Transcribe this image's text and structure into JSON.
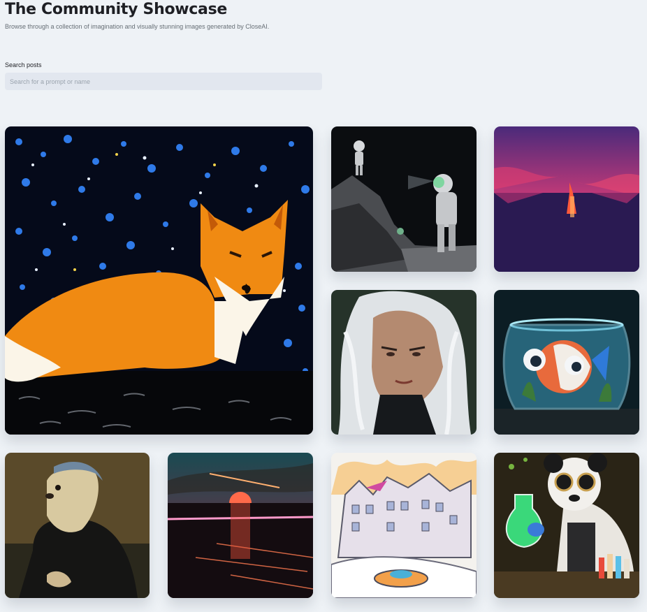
{
  "header": {
    "title": "The Community Showcase",
    "subtitle": "Browse through a collection of imagination and visually stunning images generated by CloseAI."
  },
  "search": {
    "label": "Search posts",
    "placeholder": "Search for a prompt or name",
    "value": ""
  }
}
